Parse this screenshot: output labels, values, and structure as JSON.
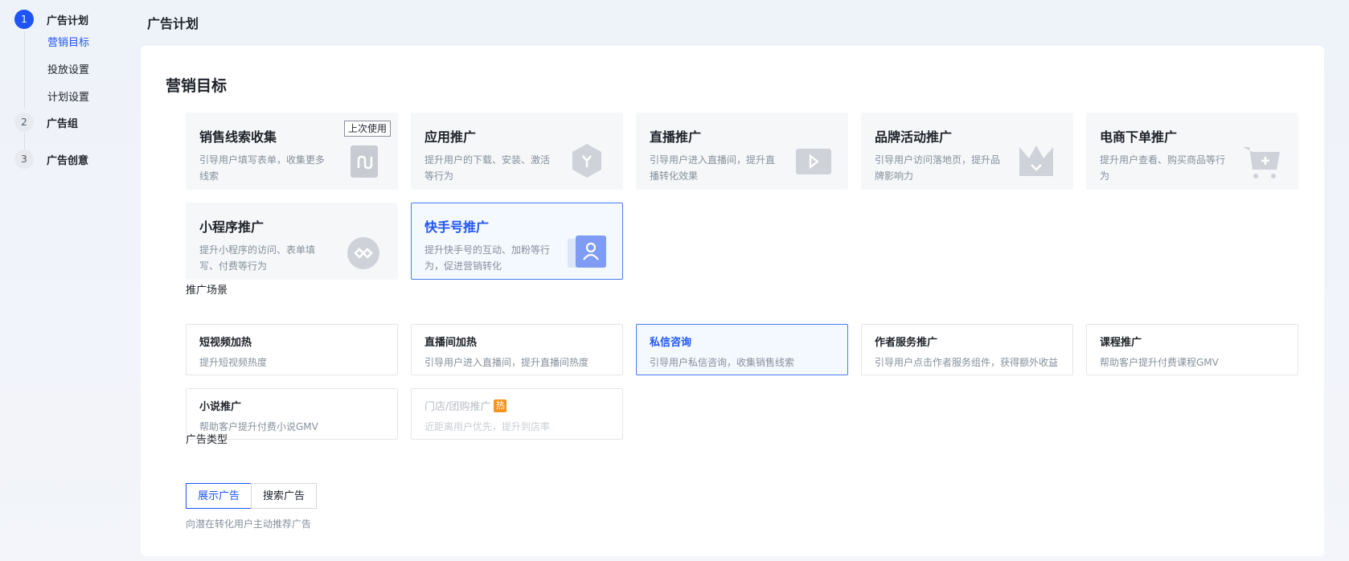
{
  "stepper": {
    "steps": [
      {
        "num": "1",
        "label": "广告计划"
      },
      {
        "num": "2",
        "label": "广告组"
      },
      {
        "num": "3",
        "label": "广告创意"
      }
    ],
    "substeps": [
      "营销目标",
      "投放设置",
      "计划设置"
    ]
  },
  "header": {
    "title": "广告计划"
  },
  "marketing": {
    "title": "营销目标",
    "badge": "上次使用",
    "goals": [
      {
        "title": "销售线索收集",
        "desc": "引导用户填写表单，收集更多线索"
      },
      {
        "title": "应用推广",
        "desc": "提升用户的下载、安装、激活等行为"
      },
      {
        "title": "直播推广",
        "desc": "引导用户进入直播间，提升直播转化效果"
      },
      {
        "title": "品牌活动推广",
        "desc": "引导用户访问落地页，提升品牌影响力"
      },
      {
        "title": "电商下单推广",
        "desc": "提升用户查看、购买商品等行为"
      },
      {
        "title": "小程序推广",
        "desc": "提升小程序的访问、表单填写、付费等行为"
      },
      {
        "title": "快手号推广",
        "desc": "提升快手号的互动、加粉等行为，促进营销转化"
      }
    ]
  },
  "scenes": {
    "label": "推广场景",
    "hot": "热",
    "items": [
      {
        "title": "短视频加热",
        "desc": "提升短视频热度"
      },
      {
        "title": "直播间加热",
        "desc": "引导用户进入直播间，提升直播间热度"
      },
      {
        "title": "私信咨询",
        "desc": "引导用户私信咨询，收集销售线索"
      },
      {
        "title": "作者服务推广",
        "desc": "引导用户点击作者服务组件，获得额外收益"
      },
      {
        "title": "课程推广",
        "desc": "帮助客户提升付费课程GMV"
      },
      {
        "title": "小说推广",
        "desc": "帮助客户提升付费小说GMV"
      },
      {
        "title": "门店/团购推广",
        "desc": "近距离用户优先，提升到店率"
      }
    ]
  },
  "ad_type": {
    "label": "广告类型",
    "options": [
      "展示广告",
      "搜索广告"
    ],
    "desc": "向潜在转化用户主动推荐广告"
  },
  "colors": {
    "accent": "#1f55f4",
    "hot": "#f7931e"
  }
}
